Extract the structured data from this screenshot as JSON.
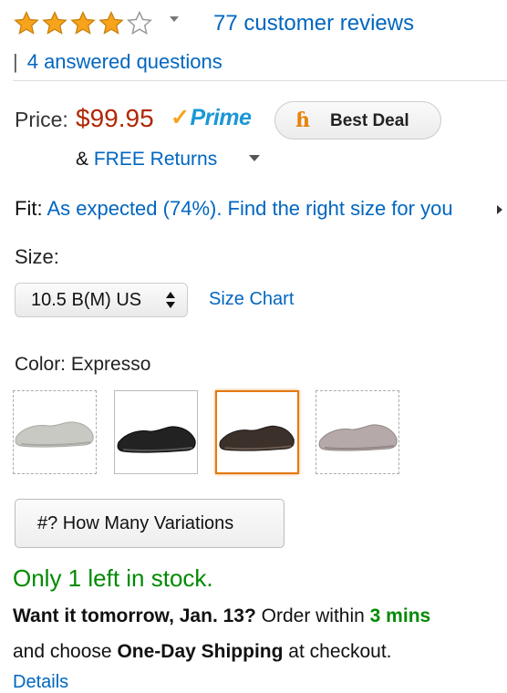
{
  "rating": {
    "value": 4,
    "max": 5,
    "star_color": "#f7a31c",
    "reviews_link": "77 customer reviews",
    "separator": "|",
    "answered_link": "4 answered questions"
  },
  "price": {
    "label": "Price:",
    "amount": "$99.95",
    "prime_check": "✓",
    "prime_text": "Prime",
    "deal_icon_glyph": "ɦ",
    "deal_label": "Best Deal",
    "returns_prefix": "& ",
    "returns_link": "FREE Returns"
  },
  "fit": {
    "label": "Fit: ",
    "link": "As expected (74%). Find the right size for you"
  },
  "size": {
    "label": "Size:",
    "selected": "10.5 B(M) US",
    "chart_link": "Size Chart"
  },
  "color": {
    "label": "Color: Expresso",
    "swatches": [
      {
        "name": "light-gray",
        "color": "#c9c9c4",
        "shade": "#a9a9a4",
        "selected": false
      },
      {
        "name": "black",
        "color": "#222222",
        "shade": "#0a0a0a",
        "selected": false
      },
      {
        "name": "expresso",
        "color": "#3b302a",
        "shade": "#1e1714",
        "selected": true
      },
      {
        "name": "taupe",
        "color": "#b5aaa9",
        "shade": "#928786",
        "selected": false
      }
    ]
  },
  "variations_button": "#? How Many Variations",
  "stock": "Only 1 left in stock.",
  "delivery": {
    "bold1": "Want it tomorrow, Jan. 13?",
    "text1": " Order within ",
    "countdown": "3 mins",
    "text2": "and choose ",
    "bold2": "One-Day Shipping",
    "text3": " at checkout.",
    "details_link": "Details"
  }
}
